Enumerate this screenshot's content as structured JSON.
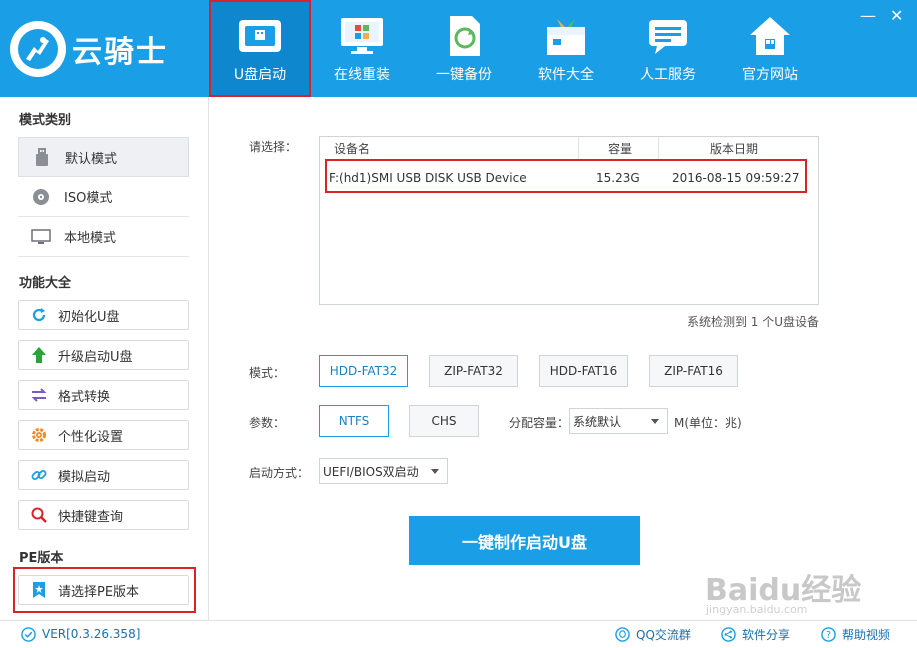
{
  "app": {
    "logo_text": "云骑士"
  },
  "nav": [
    {
      "label": "U盘启动",
      "active": true
    },
    {
      "label": "在线重装"
    },
    {
      "label": "一键备份"
    },
    {
      "label": "软件大全"
    },
    {
      "label": "人工服务"
    },
    {
      "label": "官方网站"
    }
  ],
  "window": {
    "minimize": "—",
    "close": "✕"
  },
  "sidebar": {
    "mode_title": "模式类别",
    "modes": [
      {
        "label": "默认模式",
        "icon": "usb-drive-icon"
      },
      {
        "label": "ISO模式",
        "icon": "disc-icon"
      },
      {
        "label": "本地模式",
        "icon": "monitor-icon"
      }
    ],
    "func_title": "功能大全",
    "functions": [
      {
        "label": "初始化U盘",
        "icon": "refresh-icon"
      },
      {
        "label": "升级启动U盘",
        "icon": "upgrade-arrow-icon"
      },
      {
        "label": "格式转换",
        "icon": "swap-icon"
      },
      {
        "label": "个性化设置",
        "icon": "gear-icon"
      },
      {
        "label": "模拟启动",
        "icon": "link-icon"
      },
      {
        "label": "快捷键查询",
        "icon": "search-icon"
      }
    ],
    "pe_title": "PE版本",
    "pe_button": "请选择PE版本"
  },
  "main": {
    "select_label": "请选择：",
    "table": {
      "headers": [
        "设备名",
        "容量",
        "版本日期"
      ],
      "rows": [
        [
          "F:(hd1)SMI USB DISK USB Device",
          "15.23G",
          "2016-08-15 09:59:27"
        ]
      ]
    },
    "detect_text": "系统检测到 1 个U盘设备",
    "mode_label": "模式：",
    "modes": [
      "HDD-FAT32",
      "ZIP-FAT32",
      "HDD-FAT16",
      "ZIP-FAT16"
    ],
    "param_label": "参数：",
    "params": [
      "NTFS",
      "CHS"
    ],
    "alloc_label": "分配容量：",
    "alloc_value": "系统默认",
    "alloc_unit": "M(单位：兆)",
    "boot_label": "启动方式：",
    "boot_value": "UEFI/BIOS双启动",
    "make_button": "一键制作启动U盘"
  },
  "watermark": {
    "main": "Baidu经验",
    "sub": "jingyan.baidu.com"
  },
  "footer": {
    "version": "VER[0.3.26.358]",
    "qq_group": "QQ交流群",
    "share": "软件分享",
    "help": "帮助视频"
  },
  "colors": {
    "brand": "#1a9fe6",
    "highlight": "#d8232a"
  }
}
